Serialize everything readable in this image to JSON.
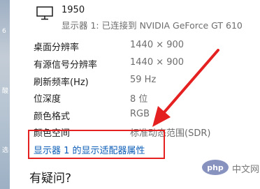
{
  "display": {
    "name": "1950",
    "subtitle": "显示器 1: 已连接到 NVIDIA GeForce GT 610"
  },
  "info_rows": [
    {
      "label": "桌面分辨率",
      "value": "1440 × 900"
    },
    {
      "label": "有源信号分辨率",
      "value": "1440 × 900"
    },
    {
      "label": "刷新频率(Hz)",
      "value": "59 Hz"
    },
    {
      "label": "位深度",
      "value": "8 位"
    },
    {
      "label": "颜色格式",
      "value": "RGB"
    },
    {
      "label": "颜色空间",
      "value": "标准动态范围(SDR)"
    }
  ],
  "adapter_link": "显示器 1 的显示适配器属性",
  "help_title": "有疑问?",
  "watermark": {
    "logo": "php",
    "text": "中文网"
  },
  "left_strip_marks": [
    "6",
    "酸",
    "选"
  ],
  "colors": {
    "link": "#0a5cb8",
    "highlight": "#e52020",
    "secondary_text": "#6d6d6d"
  }
}
